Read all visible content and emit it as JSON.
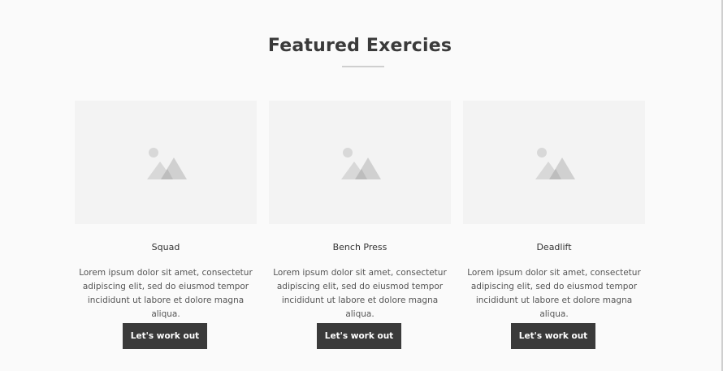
{
  "section": {
    "title": "Featured Exercies"
  },
  "cards": [
    {
      "title": "Squad",
      "text": "Lorem ipsum dolor sit amet, consectetur adipiscing elit, sed do eiusmod tempor incididunt ut labore et dolore magna aliqua.",
      "button_label": "Let's work out",
      "image_icon": "image-placeholder-icon"
    },
    {
      "title": "Bench Press",
      "text": "Lorem ipsum dolor sit amet, consectetur adipiscing elit, sed do eiusmod tempor incididunt ut labore et dolore magna aliqua.",
      "button_label": "Let's work out",
      "image_icon": "image-placeholder-icon"
    },
    {
      "title": "Deadlift",
      "text": "Lorem ipsum dolor sit amet, consectetur adipiscing elit, sed do eiusmod tempor incididunt ut labore et dolore magna aliqua.",
      "button_label": "Let's work out",
      "image_icon": "image-placeholder-icon"
    }
  ],
  "colors": {
    "background": "#fafafa",
    "heading": "#3a3a3a",
    "button": "#3a3a3a",
    "button_text": "#ffffff",
    "image_placeholder": "#f3f3f3"
  }
}
